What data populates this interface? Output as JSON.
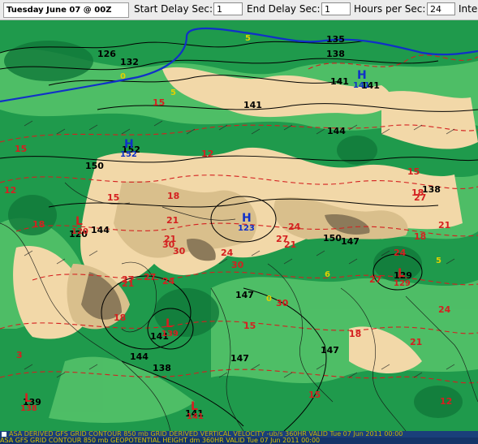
{
  "controls": {
    "title": "Tuesday June 07 @ 00Z",
    "start_delay_label": "Start Delay Sec:",
    "start_delay_value": "1",
    "end_delay_label": "End Delay Sec:",
    "end_delay_value": "1",
    "hours_per_sec_label": "Hours per Sec:",
    "hours_per_sec_value": "24",
    "interval_label": "Inte"
  },
  "colors": {
    "ocean": "#1f9a4c",
    "land_light": "#f2d8a8",
    "land_mid": "#d9bf8c",
    "land_dark": "#8c7a5a",
    "green_light": "#56c46a",
    "contour_black": "#000000",
    "contour_red": "#d42020",
    "contour_blue": "#1030c8",
    "caption_text": "#c8b400"
  },
  "map": {
    "height_labels": [
      "126",
      "132",
      "135",
      "138",
      "141",
      "141",
      "141",
      "144",
      "150",
      "152",
      "144",
      "150",
      "147",
      "147",
      "141",
      "144",
      "147",
      "138",
      "139",
      "141",
      "120",
      "129",
      "138",
      "147"
    ],
    "temp_labels": [
      "15",
      "12",
      "15",
      "12",
      "15",
      "18",
      "21",
      "24",
      "27",
      "30",
      "30",
      "27",
      "24",
      "21",
      "18",
      "15",
      "18",
      "21",
      "24",
      "27",
      "30",
      "27",
      "24",
      "21",
      "18",
      "15",
      "12",
      "9",
      "6",
      "3",
      "18",
      "15",
      "21",
      "18",
      "24",
      "30",
      "27",
      "21"
    ],
    "vertical_velocity_labels": [
      "5",
      "5",
      "5",
      "0",
      "0",
      "6"
    ],
    "center_markers": [
      {
        "letter": "H",
        "value": "152",
        "color": "blue"
      },
      {
        "letter": "H",
        "value": "141",
        "color": "blue"
      },
      {
        "letter": "H",
        "value": "123",
        "color": "blue"
      },
      {
        "letter": "L",
        "value": "120",
        "color": "red"
      },
      {
        "letter": "L",
        "value": "129",
        "color": "red"
      },
      {
        "letter": "L",
        "value": "139",
        "color": "red"
      },
      {
        "letter": "L",
        "value": "141",
        "color": "red"
      },
      {
        "letter": "L",
        "value": "138",
        "color": "red"
      }
    ]
  },
  "captions": {
    "line1": "ASA DERIVED GFS GRID CONTOUR 850 mb GRID DERIVED VERTICAL VELOCITY -ub/s 360HR VALID Tue 07 Jun 2011 00:00",
    "line2": "ASA GFS GRID CONTOUR 850 mb GEOPOTENTIAL HEIGHT dm 360HR VALID Tue 07 Jun 2011 00:00"
  }
}
